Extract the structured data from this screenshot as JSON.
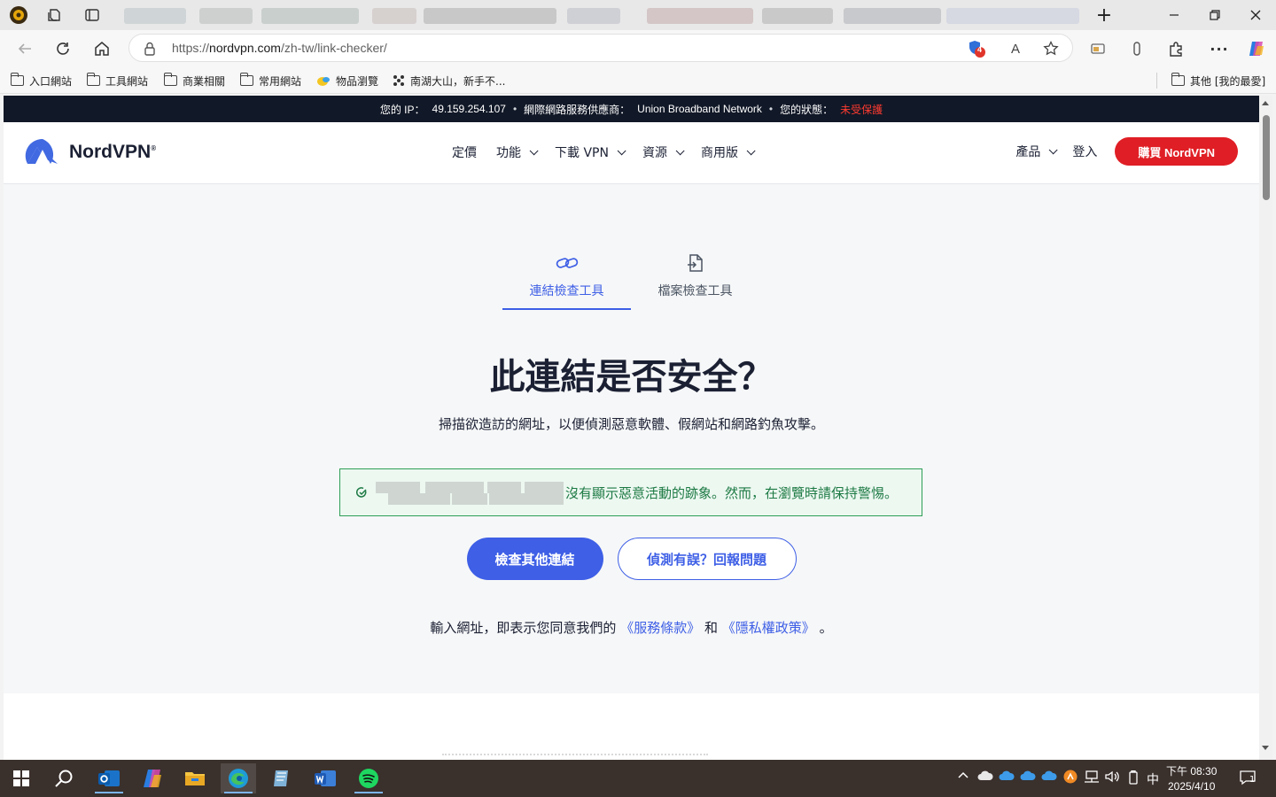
{
  "browser": {
    "url_prefix": "https://",
    "url_host": "nordvpn.com",
    "url_path": "/zh-tw/link-checker/",
    "shield_badge_count": "4",
    "read_aloud_glyph": "A",
    "bookmarks": [
      {
        "label": "入口網站",
        "icon": "folder-icon"
      },
      {
        "label": "工具網站",
        "icon": "folder-icon"
      },
      {
        "label": "商業相關",
        "icon": "folder-icon"
      },
      {
        "label": "常用網站",
        "icon": "folder-icon"
      },
      {
        "label": "物品瀏覽",
        "icon": "site-icon"
      },
      {
        "label": "南湖大山，新手不...",
        "icon": "site-icon"
      }
    ],
    "other_bookmarks_label": "其他 [我的最愛]"
  },
  "site": {
    "ip_bar": {
      "ip_label": "您的 IP：",
      "ip_value": "49.159.254.107",
      "isp_label": "網際網路服務供應商：",
      "isp_value": "Union Broadband Network",
      "status_label": "您的狀態：",
      "status_value": "未受保護",
      "separator": "•"
    },
    "logo_text": "NordVPN",
    "logo_mark": "®",
    "nav": [
      "定價",
      "功能",
      "下載 VPN",
      "資源",
      "商用版"
    ],
    "nav_has_dropdown": [
      false,
      true,
      true,
      true,
      true
    ],
    "products_label": "產品",
    "login_label": "登入",
    "buy_label": "購買 NordVPN"
  },
  "checker": {
    "tabs": [
      {
        "label": "連結檢查工具",
        "active": true
      },
      {
        "label": "檔案檢查工具",
        "active": false
      }
    ],
    "title": "此連結是否安全？",
    "subtitle": "掃描欲造訪的網址，以便偵測惡意軟體、假網站和網路釣魚攻擊。",
    "result_text": "沒有顯示惡意活動的跡象。然而，在瀏覽時請保持警惕。",
    "check_again_label": "檢查其他連結",
    "report_label": "偵測有誤？回報問題",
    "terms_prefix": "輸入網址，即表示您同意我們的",
    "terms_link": "《服務條款》",
    "terms_and": "和",
    "privacy_link": "《隱私權政策》",
    "terms_suffix": "。"
  },
  "colors": {
    "accent": "#3e5fe6",
    "buy_red": "#e01e25",
    "safe_green": "#1d7a44",
    "warn_red": "#ff3b30"
  },
  "taskbar": {
    "clock_time": "下午 08:30",
    "clock_date": "2025/4/10",
    "ime_label": "中",
    "notification_count": "1"
  }
}
